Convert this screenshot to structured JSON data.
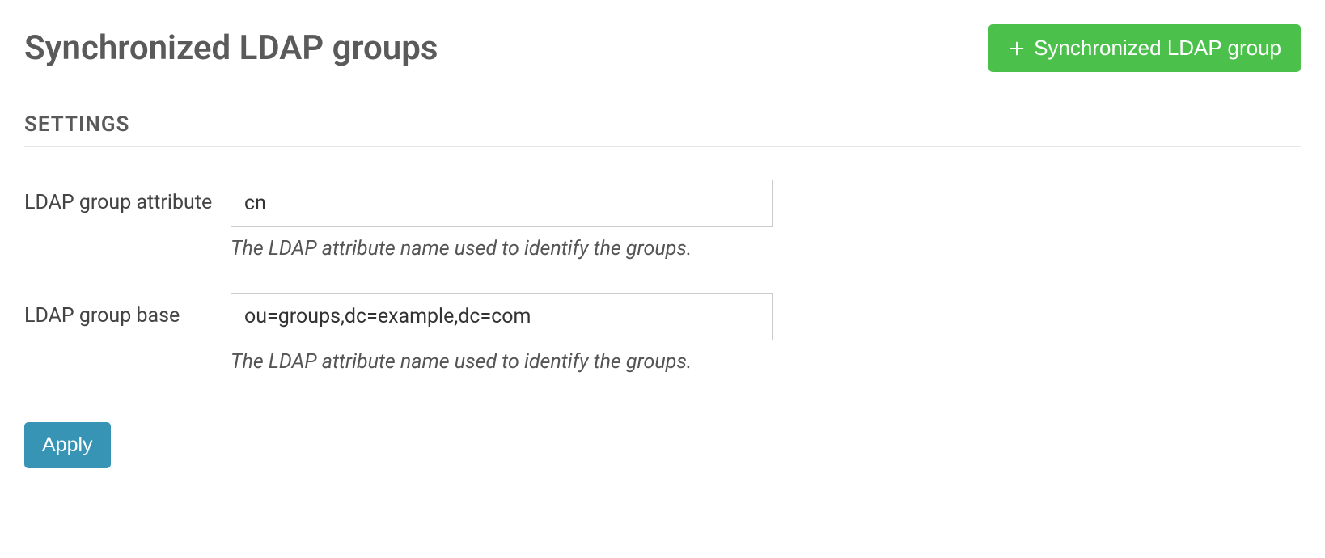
{
  "header": {
    "title": "Synchronized LDAP groups",
    "add_button_label": "Synchronized LDAP group"
  },
  "section": {
    "heading": "SETTINGS"
  },
  "fields": {
    "group_attribute": {
      "label": "LDAP group attribute",
      "value": "cn",
      "help": "The LDAP attribute name used to identify the groups."
    },
    "group_base": {
      "label": "LDAP group base",
      "value": "ou=groups,dc=example,dc=com",
      "help": "The LDAP attribute name used to identify the groups."
    }
  },
  "actions": {
    "apply_label": "Apply"
  }
}
